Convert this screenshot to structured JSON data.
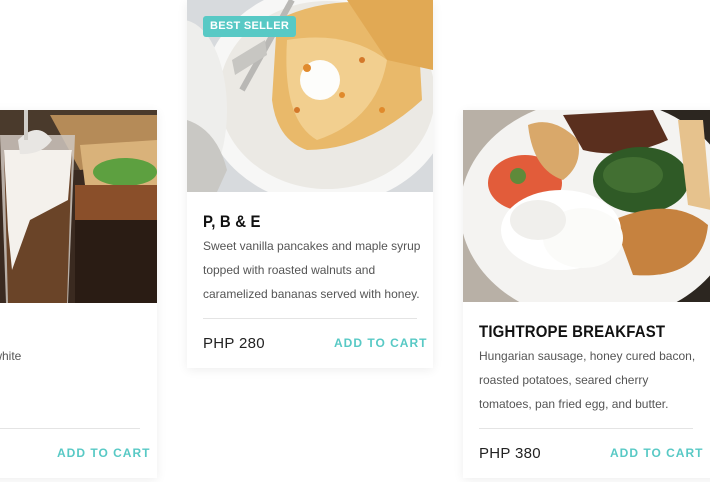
{
  "cards": [
    {
      "description_lines": [
        "twhite"
      ],
      "add_to_cart": "ADD TO CART"
    },
    {
      "badge": "BEST SELLER",
      "title": "P, B & E",
      "description_lines": [
        "Sweet vanilla pancakes and maple syrup",
        "topped with roasted walnuts and",
        "caramelized bananas served with honey."
      ],
      "price": "PHP 280",
      "add_to_cart": "ADD TO CART"
    },
    {
      "title": "TIGHTROPE BREAKFAST",
      "description_lines": [
        "Hungarian sausage, honey cured bacon,",
        "roasted potatoes, seared cherry",
        "tomatoes, pan fried  egg, and butter."
      ],
      "price": "PHP 380",
      "add_to_cart": "ADD TO CART"
    }
  ],
  "colors": {
    "accent": "#58c9c5",
    "text": "#111111",
    "muted": "#555555"
  },
  "icons": [
    "food-photo-iced-coffee",
    "food-photo-crepe",
    "food-photo-breakfast-plate"
  ]
}
